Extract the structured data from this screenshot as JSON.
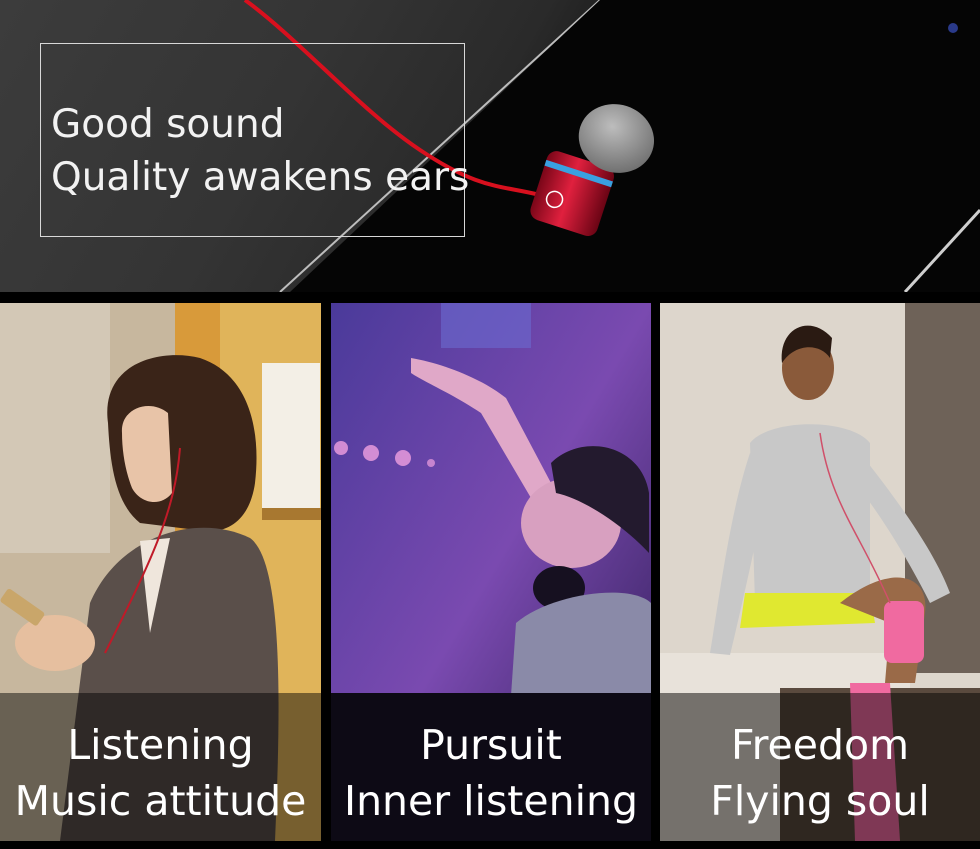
{
  "hero": {
    "line1": "Good sound",
    "line2": "Quality awakens ears"
  },
  "panels": [
    {
      "line1": "Listening",
      "line2": "Music attitude"
    },
    {
      "line1": "Pursuit",
      "line2": "Inner listening"
    },
    {
      "line1": "Freedom",
      "line2": "Flying soul"
    }
  ],
  "colors": {
    "cable": "#d8101e",
    "earbud_body": "#c2102a",
    "accent_ring": "#3aa0e0"
  }
}
